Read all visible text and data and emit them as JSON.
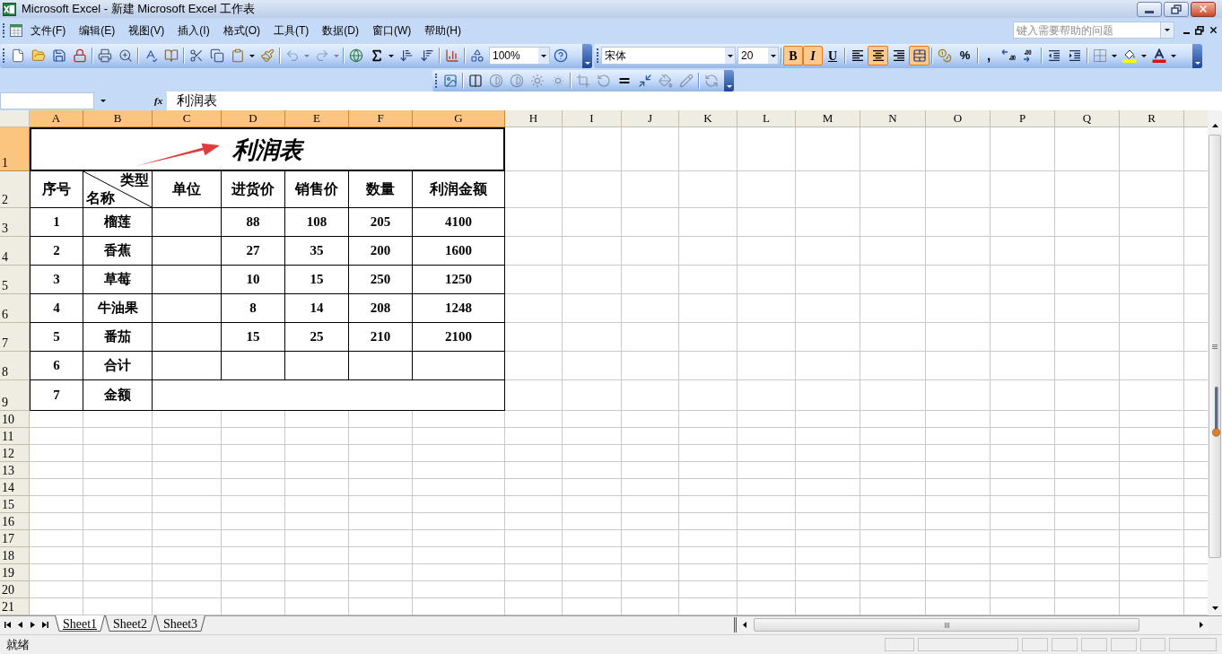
{
  "window": {
    "title": "Microsoft Excel - 新建 Microsoft Excel 工作表"
  },
  "menu_bar": {
    "items": [
      "文件(F)",
      "编辑(E)",
      "视图(V)",
      "插入(I)",
      "格式(O)",
      "工具(T)",
      "数据(D)",
      "窗口(W)",
      "帮助(H)"
    ],
    "help_box": {
      "placeholder": "键入需要帮助的问题"
    }
  },
  "standard_toolbar": {
    "undo": {
      "disabled": true
    },
    "redo": {
      "disabled": true
    },
    "zoom": "100%"
  },
  "formatting_toolbar": {
    "font": "宋体",
    "font_size": "20",
    "bold": {
      "label": "B",
      "pressed": true
    },
    "italic": {
      "label": "I",
      "pressed": true
    },
    "underline": {
      "label": "U",
      "pressed": false
    },
    "align_left": {
      "pressed": false
    },
    "align_center": {
      "pressed": true
    },
    "align_right": {
      "pressed": false
    },
    "merge_and_center": {
      "pressed": true
    },
    "percent": {
      "label": "%"
    },
    "comma": {
      "label": ","
    }
  },
  "picture_toolbar": {
    "buttons": [
      {
        "disabled": false
      },
      {
        "disabled": false
      },
      {
        "disabled": true
      },
      {
        "disabled": true
      },
      {
        "disabled": true
      },
      {
        "disabled": true
      },
      {
        "disabled": true
      },
      {
        "disabled": true
      },
      {
        "disabled": false
      },
      {
        "disabled": false
      },
      {
        "disabled": true
      },
      {
        "disabled": true
      },
      {
        "disabled": true
      }
    ]
  },
  "formula_bar": {
    "function_label": "fx",
    "content": "利润表"
  },
  "sheet": {
    "columns": [
      {
        "label": "A",
        "selected": true
      },
      {
        "label": "B",
        "selected": true
      },
      {
        "label": "C",
        "selected": true
      },
      {
        "label": "D",
        "selected": true
      },
      {
        "label": "E",
        "selected": true
      },
      {
        "label": "F",
        "selected": true
      },
      {
        "label": "G",
        "selected": true
      },
      {
        "label": "H",
        "selected": false
      },
      {
        "label": "I",
        "selected": false
      },
      {
        "label": "J",
        "selected": false
      },
      {
        "label": "K",
        "selected": false
      },
      {
        "label": "L",
        "selected": false
      },
      {
        "label": "M",
        "selected": false
      },
      {
        "label": "N",
        "selected": false
      },
      {
        "label": "O",
        "selected": false
      },
      {
        "label": "P",
        "selected": false
      },
      {
        "label": "Q",
        "selected": false
      },
      {
        "label": "R",
        "selected": false
      }
    ],
    "rows": [
      {
        "label": "1",
        "selected": true
      },
      {
        "label": "2",
        "selected": false
      },
      {
        "label": "3",
        "selected": false
      },
      {
        "label": "4",
        "selected": false
      },
      {
        "label": "5",
        "selected": false
      },
      {
        "label": "6",
        "selected": false
      },
      {
        "label": "7",
        "selected": false
      },
      {
        "label": "8",
        "selected": false
      },
      {
        "label": "9",
        "selected": false
      },
      {
        "label": "10",
        "selected": false
      },
      {
        "label": "11",
        "selected": false
      },
      {
        "label": "12",
        "selected": false
      },
      {
        "label": "13",
        "selected": false
      },
      {
        "label": "14",
        "selected": false
      },
      {
        "label": "15",
        "selected": false
      },
      {
        "label": "16",
        "selected": false
      },
      {
        "label": "17",
        "selected": false
      },
      {
        "label": "18",
        "selected": false
      },
      {
        "label": "19",
        "selected": false
      },
      {
        "label": "20",
        "selected": false
      },
      {
        "label": "21",
        "selected": false
      }
    ],
    "table": {
      "title": "利润表",
      "header": [
        {
          "kind": "text",
          "text": "序号"
        },
        {
          "kind": "diagonal",
          "top_right": "类型",
          "bottom_left": "名称"
        },
        {
          "kind": "text",
          "text": "单位"
        },
        {
          "kind": "text",
          "text": "进货价"
        },
        {
          "kind": "text",
          "text": "销售价"
        },
        {
          "kind": "text",
          "text": "数量"
        },
        {
          "kind": "text",
          "text": "利润金额"
        }
      ],
      "rows": [
        {
          "kind": "regular",
          "index": "1",
          "name": "榴莲",
          "purchase_price": "88",
          "sale_price": "108",
          "quantity": "205",
          "profit": "4100"
        },
        {
          "kind": "regular",
          "index": "2",
          "name": "香蕉",
          "purchase_price": "27",
          "sale_price": "35",
          "quantity": "200",
          "profit": "1600"
        },
        {
          "kind": "regular",
          "index": "3",
          "name": "草莓",
          "purchase_price": "10",
          "sale_price": "15",
          "quantity": "250",
          "profit": "1250"
        },
        {
          "kind": "regular",
          "index": "4",
          "name": "牛油果",
          "purchase_price": "8",
          "sale_price": "14",
          "quantity": "208",
          "profit": "1248"
        },
        {
          "kind": "regular",
          "index": "5",
          "name": "番茄",
          "purchase_price": "15",
          "sale_price": "25",
          "quantity": "210",
          "profit": "2100"
        },
        {
          "kind": "regular",
          "index": "6",
          "name": "合计"
        },
        {
          "kind": "merged",
          "index": "7",
          "name": "金额"
        }
      ]
    }
  },
  "sheet_tabs": [
    {
      "label": "Sheet1",
      "selected": true
    },
    {
      "label": "Sheet2",
      "selected": false
    },
    {
      "label": "Sheet3",
      "selected": false
    }
  ],
  "status_bar": {
    "text": "就绪"
  }
}
